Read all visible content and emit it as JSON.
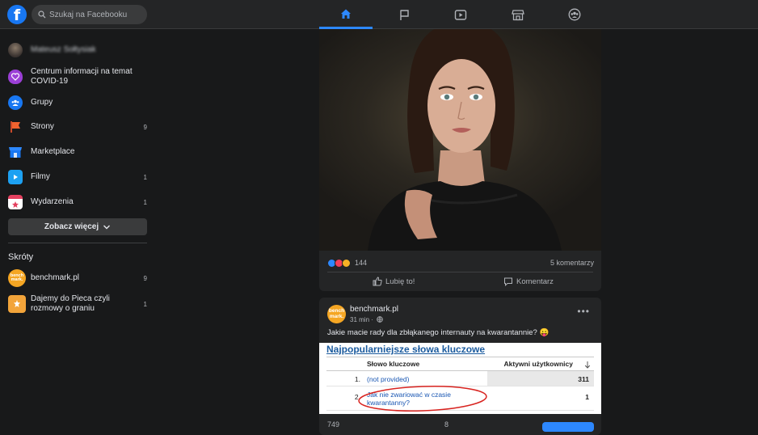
{
  "header": {
    "logo_glyph": "f",
    "search_placeholder": "Szukaj na Facebooku",
    "tabs": [
      "home-icon",
      "flag-icon",
      "video-icon",
      "marketplace-icon",
      "groups-icon"
    ],
    "accent": "#2d88ff"
  },
  "sidebar": {
    "user_name": "Mateusz Sołtysiak",
    "items": [
      {
        "label": "Centrum informacji na temat COVID-19",
        "count": ""
      },
      {
        "label": "Grupy",
        "count": ""
      },
      {
        "label": "Strony",
        "count": "9"
      },
      {
        "label": "Marketplace",
        "count": ""
      },
      {
        "label": "Filmy",
        "count": "1"
      },
      {
        "label": "Wydarzenia",
        "count": "1"
      }
    ],
    "see_more": "Zobacz więcej",
    "shortcuts_title": "Skróty",
    "shortcuts": [
      {
        "label": "benchmark.pl",
        "count": "9",
        "avatar_text": "bench mark."
      },
      {
        "label": "Dajemy do Pieca czyli rozmowy o graniu",
        "count": "1"
      }
    ]
  },
  "post1": {
    "reaction_count": "144",
    "comments": "5 komentarzy",
    "like_label": "Lubię to!",
    "comment_label": "Komentarz"
  },
  "post2": {
    "author": "benchmark.pl",
    "time": "31 min ·",
    "text": "Jakie macie rady dla zbłąkanego internauty na kwarantannie? 😛",
    "avatar_text": "bench mark.",
    "embed": {
      "title": "Najpopularniejsze słowa kluczowe",
      "col_keyword": "Słowo kluczowe",
      "col_users": "Aktywni użytkownicy",
      "rows": [
        {
          "num": "1.",
          "keyword": "(not provided)",
          "value": "311"
        },
        {
          "num": "2.",
          "keyword": "Jak nie zwariować w czasie kwarantanny?",
          "value": "1"
        }
      ]
    },
    "stats_left": "749",
    "stats_mid": "8"
  }
}
